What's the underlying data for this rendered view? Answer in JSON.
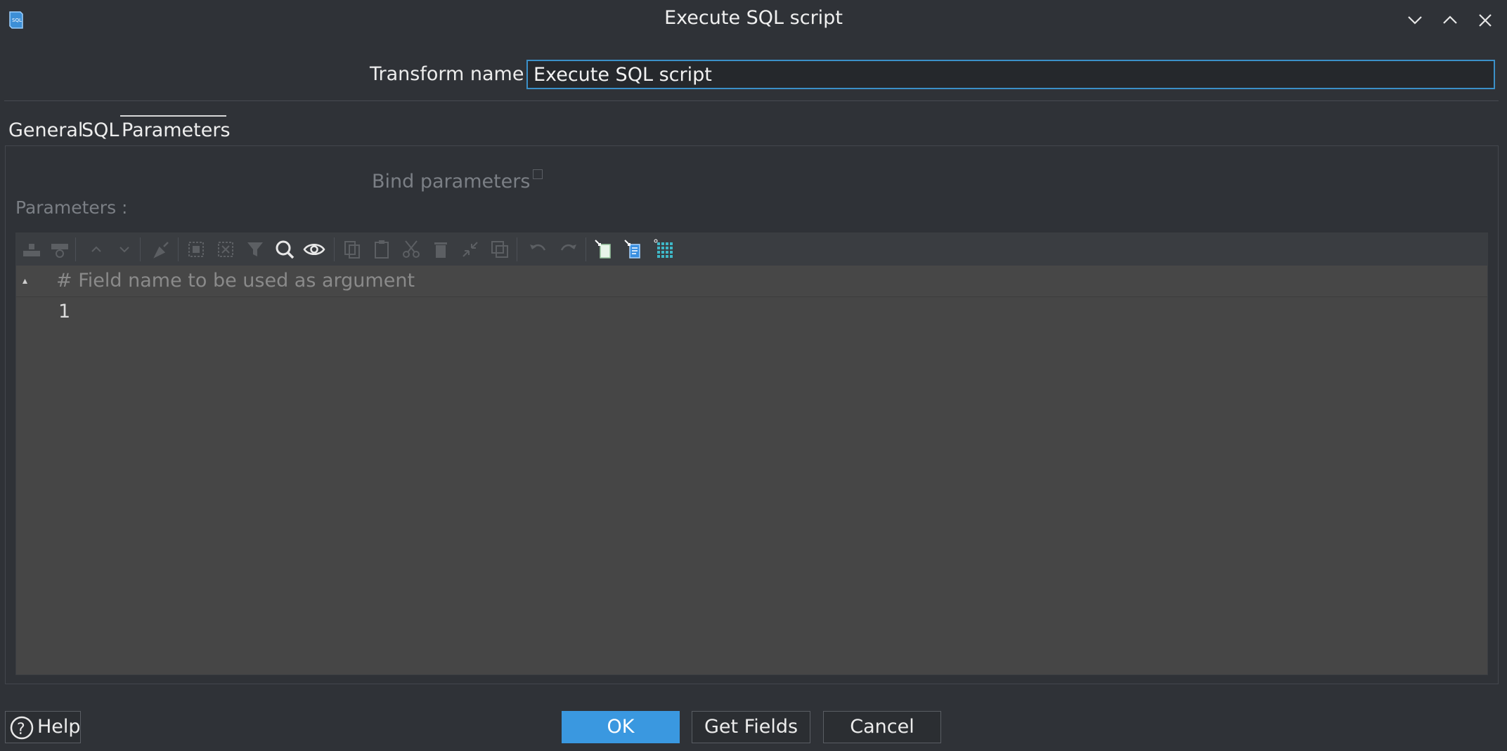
{
  "window": {
    "title": "Execute SQL script",
    "app_icon": "sql-script-icon",
    "controls": [
      "minimize-icon",
      "maximize-icon",
      "close-icon"
    ]
  },
  "transform": {
    "label": "Transform name",
    "value": "Execute SQL script"
  },
  "tabs": [
    {
      "label": "General",
      "active": false
    },
    {
      "label": "SQL",
      "active": false
    },
    {
      "label": "Parameters",
      "active": true
    }
  ],
  "parameters_tab": {
    "bind_label": "Bind parameters",
    "bind_checked": false,
    "params_label": "Parameters :",
    "toolbar_icons": [
      "insert-row-icon",
      "delete-row-icon",
      "move-up-icon",
      "move-down-icon",
      "clear-icon",
      "select-all-icon",
      "clear-selection-icon",
      "filter-icon",
      "search-icon",
      "view-icon",
      "copy-icon",
      "paste-icon",
      "cut-icon",
      "delete-icon",
      "keep-icon",
      "duplicate-icon",
      "undo-icon",
      "redo-icon",
      "get-fields-icon",
      "get-fields-blue-icon",
      "grid-icon"
    ],
    "table": {
      "columns": [
        "#",
        "Field name to be used as argument"
      ],
      "rows": [
        {
          "num": "1",
          "field": ""
        }
      ]
    }
  },
  "buttons": {
    "help": "Help",
    "ok": "OK",
    "get_fields": "Get Fields",
    "cancel": "Cancel"
  },
  "colors": {
    "background": "#2f3237",
    "accent": "#3a98e0",
    "input_border": "#3b90c8",
    "grid_background": "#464646"
  }
}
